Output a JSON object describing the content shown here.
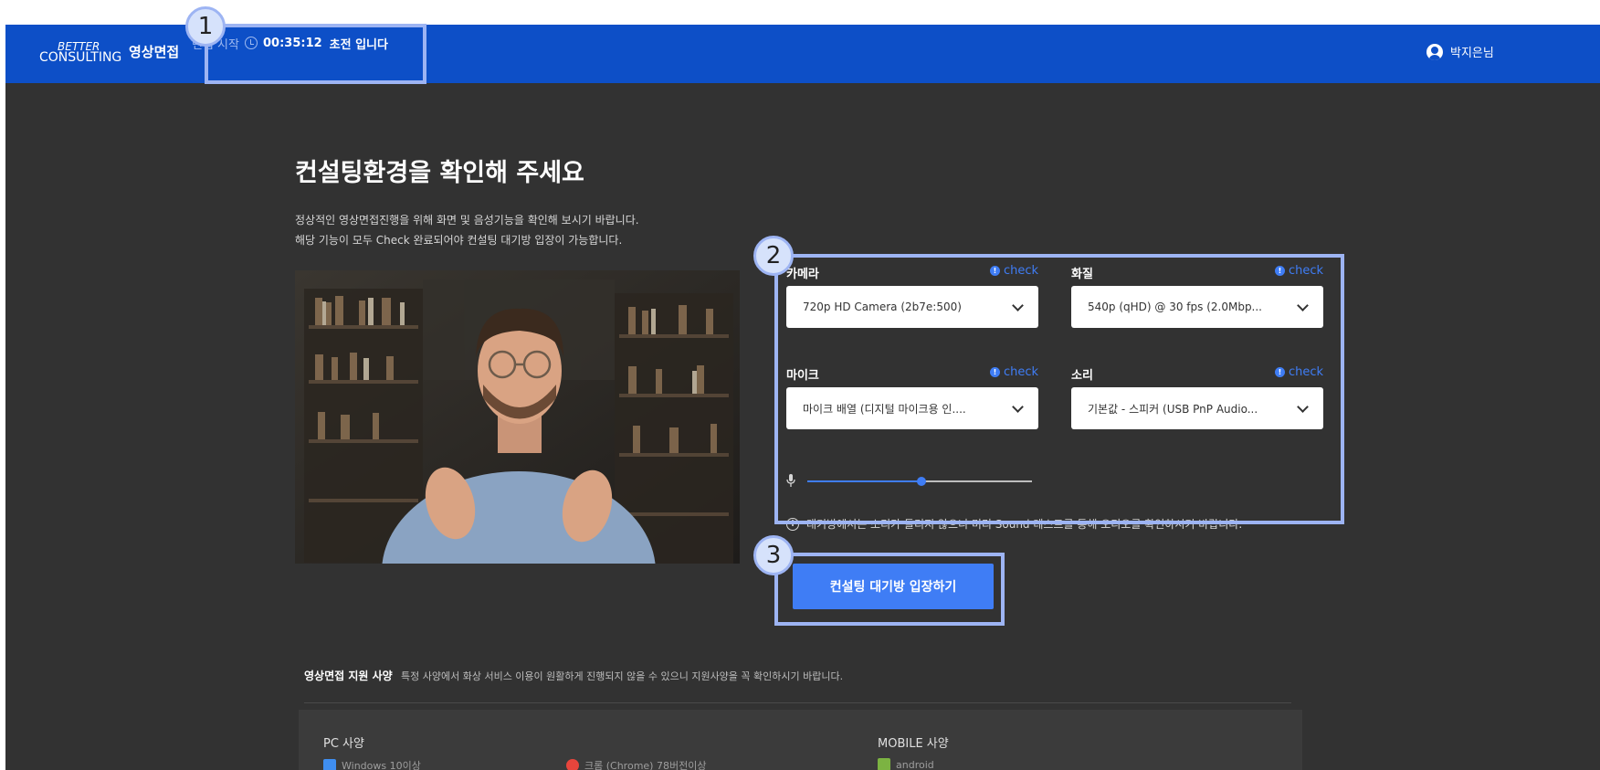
{
  "header": {
    "logo_better": "BETTER",
    "logo_consulting": "CONSULTING",
    "logo_service": "영상면접",
    "timer_label": "면접 시작",
    "timer_value": "00:35:12",
    "timer_suffix": "초전 입니다",
    "user_name": "박지은님"
  },
  "callouts": [
    "1",
    "2",
    "3"
  ],
  "main": {
    "title": "컨설팅환경을 확인해 주세요",
    "description_line1": "정상적인 영상면접진행을 위해 화면 및 음성기능을 확인해 보시기 바랍니다.",
    "description_line2": "해당 기능이 모두 Check 완료되어야 컨설팅 대기방 입장이 가능합니다."
  },
  "settings": {
    "camera": {
      "label": "카메라",
      "check": "check",
      "value": "720p HD Camera (2b7e:500)"
    },
    "quality": {
      "label": "화질",
      "check": "check",
      "value": "540p (qHD) @ 30 fps (2.0Mbp..."
    },
    "mic": {
      "label": "마이크",
      "check": "check",
      "value": "마이크 배열 (디지털 마이크용 인...."
    },
    "sound": {
      "label": "소리",
      "check": "check",
      "value": "기본값 - 스피커 (USB PnP Audio..."
    },
    "mic_level": 0.51,
    "notice": "대기방에서는 소리가 들리지 않으니 미리 Sound 테스트를 통해 오디오를 확인하시기 바랍니다."
  },
  "enter_button": "컨설팅 대기방 입장하기",
  "support": {
    "title": "영상면접 지원 사양",
    "subtitle": "특정 사양에서 화상 서비스 이용이 원활하게 진행되지 않을 수 있으니 지원사양을 꼭 확인하시기 바랍니다.",
    "pc_title": "PC 사양",
    "pc_os": "Windows 10이상",
    "pc_browser": "크롬 (Chrome) 78버전이상",
    "mobile_title": "MOBILE 사양",
    "mobile_os": "android"
  },
  "colors": {
    "header_bg": "#0d4fc7",
    "page_bg": "#323232",
    "accent": "#3f7df5",
    "callout": "#9db4f3"
  }
}
